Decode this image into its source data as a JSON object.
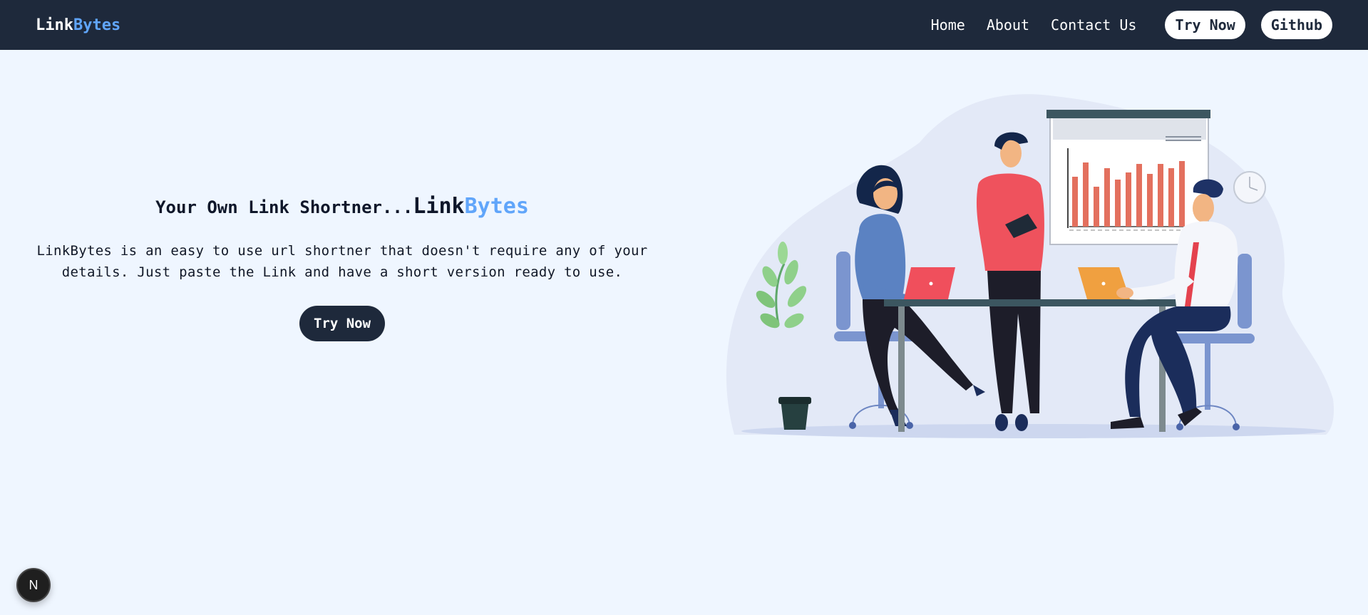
{
  "navbar": {
    "logo_part1": "Link",
    "logo_part2": "Bytes",
    "links": [
      "Home",
      "About",
      "Contact Us"
    ],
    "try_now_label": "Try Now",
    "github_label": "Github"
  },
  "hero": {
    "title_prefix": "Your Own Link Shortner...",
    "brand_part1": "Link",
    "brand_part2": "Bytes",
    "description": "LinkBytes is an easy to use url shortner that doesn't require any of your details. Just paste the Link and have a short version ready to use.",
    "cta_label": "Try Now"
  },
  "badge": {
    "letter": "N",
    "icon": "nextjs-icon"
  },
  "colors": {
    "navbar_bg": "#1e293b",
    "page_bg": "#eff6ff",
    "accent": "#60a5fa"
  }
}
